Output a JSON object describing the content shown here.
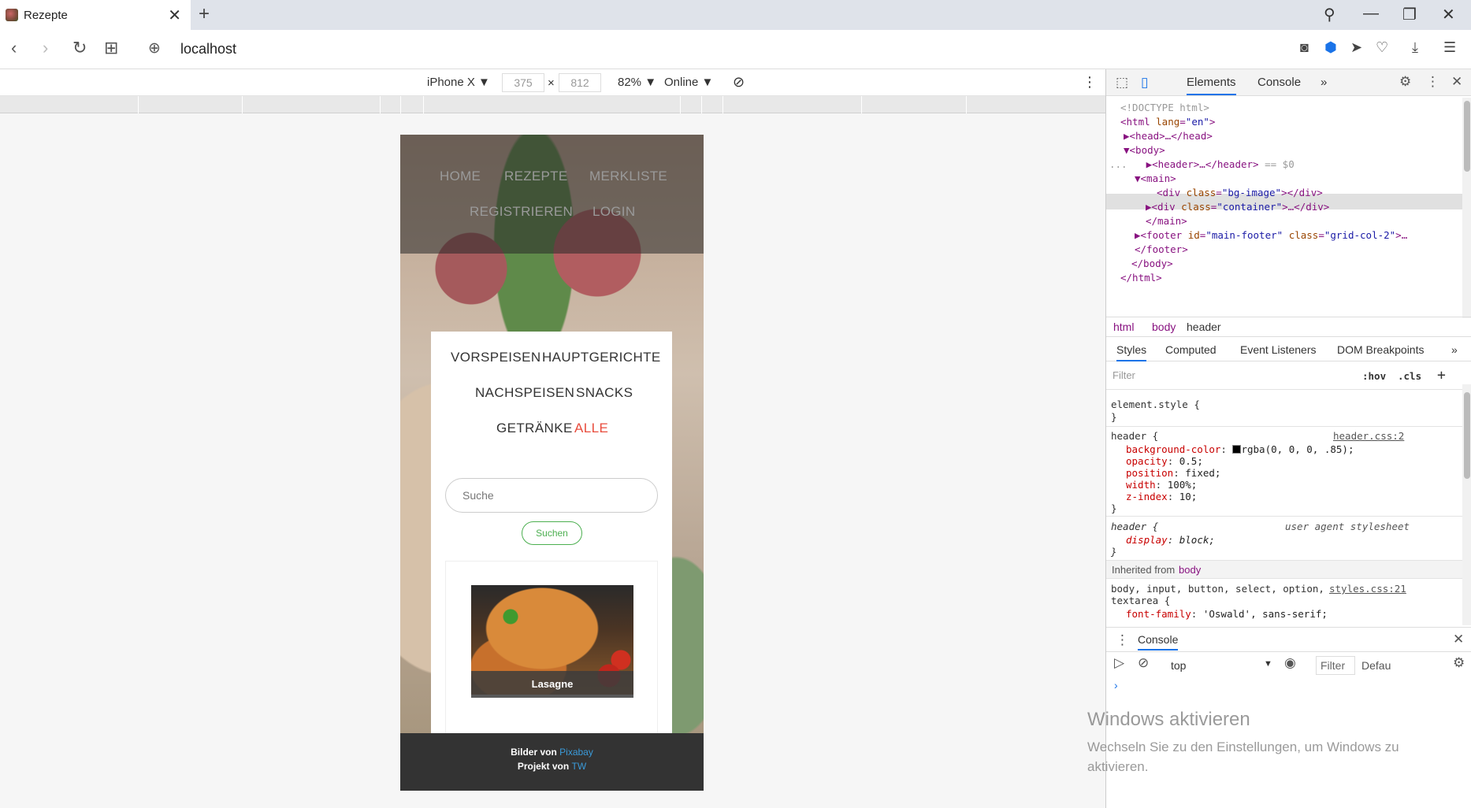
{
  "tab": {
    "title": "Rezepte",
    "close": "✕",
    "new": "+"
  },
  "window": {
    "search": "⚲",
    "minimize": "—",
    "restore": "❐",
    "close": "✕"
  },
  "address": {
    "url": "localhost",
    "back": "‹",
    "forward": "›",
    "reload": "↻",
    "grid": "⊞",
    "globe": "⊕"
  },
  "toolbar_right": {
    "camera": "◙",
    "shield": "⬢",
    "send": "➤",
    "heart": "♡",
    "download": "⤓",
    "menu": "☰"
  },
  "device_toolbar": {
    "device": "iPhone X ▼",
    "width": "375",
    "x": "×",
    "height": "812",
    "zoom": "82% ▼",
    "network": "Online ▼",
    "rotate": "⊘",
    "more": "⋮"
  },
  "site": {
    "nav": [
      "HOME",
      "REZEPTE",
      "MERKLISTE",
      "REGISTRIEREN",
      "LOGIN"
    ],
    "categories": [
      "VORSPEISEN",
      "HAUPTGERICHTE",
      "NACHSPEISEN",
      "SNACKS",
      "GETRÄNKE",
      "ALLE"
    ],
    "search_placeholder": "Suche",
    "search_button": "Suchen",
    "recipe_title": "Lasagne",
    "footer_line1_prefix": "Bilder von ",
    "footer_line1_link": "Pixabay",
    "footer_line2_prefix": "Projekt von ",
    "footer_line2_link": "TW"
  },
  "devtools": {
    "tabs": [
      "Elements",
      "Console",
      "»"
    ],
    "tree": {
      "l1": "<!DOCTYPE html>",
      "l2_tag": "<html ",
      "l2_attr": "lang",
      "l2_eq": "=",
      "l2_val": "\"en\"",
      "l2_end": ">",
      "l3": "▶<head>…</head>",
      "l4": "▼<body>",
      "l5": "▶<header>…</header>",
      "l5_eq": " == $0",
      "l6": "▼<main>",
      "l7_tag": "<div ",
      "l7_attr": "class",
      "l7_val": "\"bg-image\"",
      "l7_end": "></div>",
      "l8_tag": "▶<div ",
      "l8_attr": "class",
      "l8_val": "\"container\"",
      "l8_end": ">…</div>",
      "l9": "</main>",
      "l10_tag": "▶<footer ",
      "l10_attr1": "id",
      "l10_val1": "\"main-footer\"",
      "l10_attr2": " class",
      "l10_val2": "\"grid-col-2\"",
      "l10_end": ">…",
      "l11": "</footer>",
      "l12": "</body>",
      "l13": "</html>",
      "dots": "..."
    },
    "breadcrumbs": [
      "html",
      "body",
      "header"
    ],
    "style_tabs": [
      "Styles",
      "Computed",
      "Event Listeners",
      "DOM Breakpoints",
      "»"
    ],
    "filter_placeholder": "Filter",
    "hov": ":hov",
    "cls": ".cls",
    "plus": "+",
    "rules": {
      "el_style": "element.style {",
      "close": "}",
      "header_sel": "header {",
      "header_src": "header.css:2",
      "p1": "background-color",
      "v1": "rgba(0, 0, 0, .85);",
      "p2": "opacity",
      "v2": "0.5;",
      "p3": "position",
      "v3": "fixed;",
      "p4": "width",
      "v4": "100%;",
      "p5": "z-index",
      "v5": "10;",
      "ua_sel": "header {",
      "ua_src": "user agent stylesheet",
      "ua_p": "display",
      "ua_v": "block;",
      "inherited": "Inherited from ",
      "inherited_el": "body",
      "body_sel": "body, input, button, select, option,",
      "body_sel2": "textarea {",
      "body_src": "styles.css:21",
      "body_p": "font-family",
      "body_v": "'Oswald', sans-serif;"
    },
    "console": {
      "title": "Console",
      "context": "top",
      "filter": "Filter",
      "level": "Defau",
      "prompt": "›"
    }
  },
  "watermark": {
    "title": "Windows aktivieren",
    "line1": "Wechseln Sie zu den Einstellungen, um Windows zu",
    "line2": "aktivieren."
  }
}
